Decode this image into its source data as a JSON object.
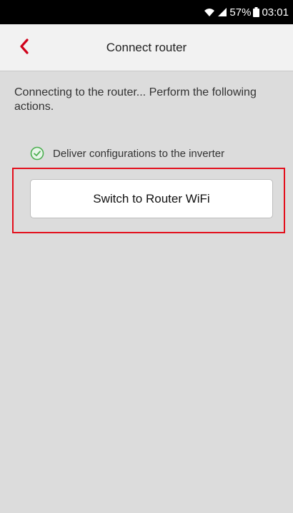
{
  "status_bar": {
    "battery": "57%",
    "time": "03:01",
    "icons": [
      "wifi-icon",
      "signal-icon",
      "battery-icon"
    ]
  },
  "header": {
    "title": "Connect router",
    "back_icon": "chevron-left-icon",
    "accent_color": "#d0021b"
  },
  "main": {
    "instruction": "Connecting to the router... Perform the following actions.",
    "steps": [
      {
        "label": "Deliver configurations to the inverter",
        "status": "done",
        "icon": "check-circle-icon",
        "color": "#4caf50"
      }
    ],
    "action_button": {
      "label": "Switch to Router WiFi",
      "highlighted": true,
      "highlight_color": "#e30f1c"
    }
  }
}
